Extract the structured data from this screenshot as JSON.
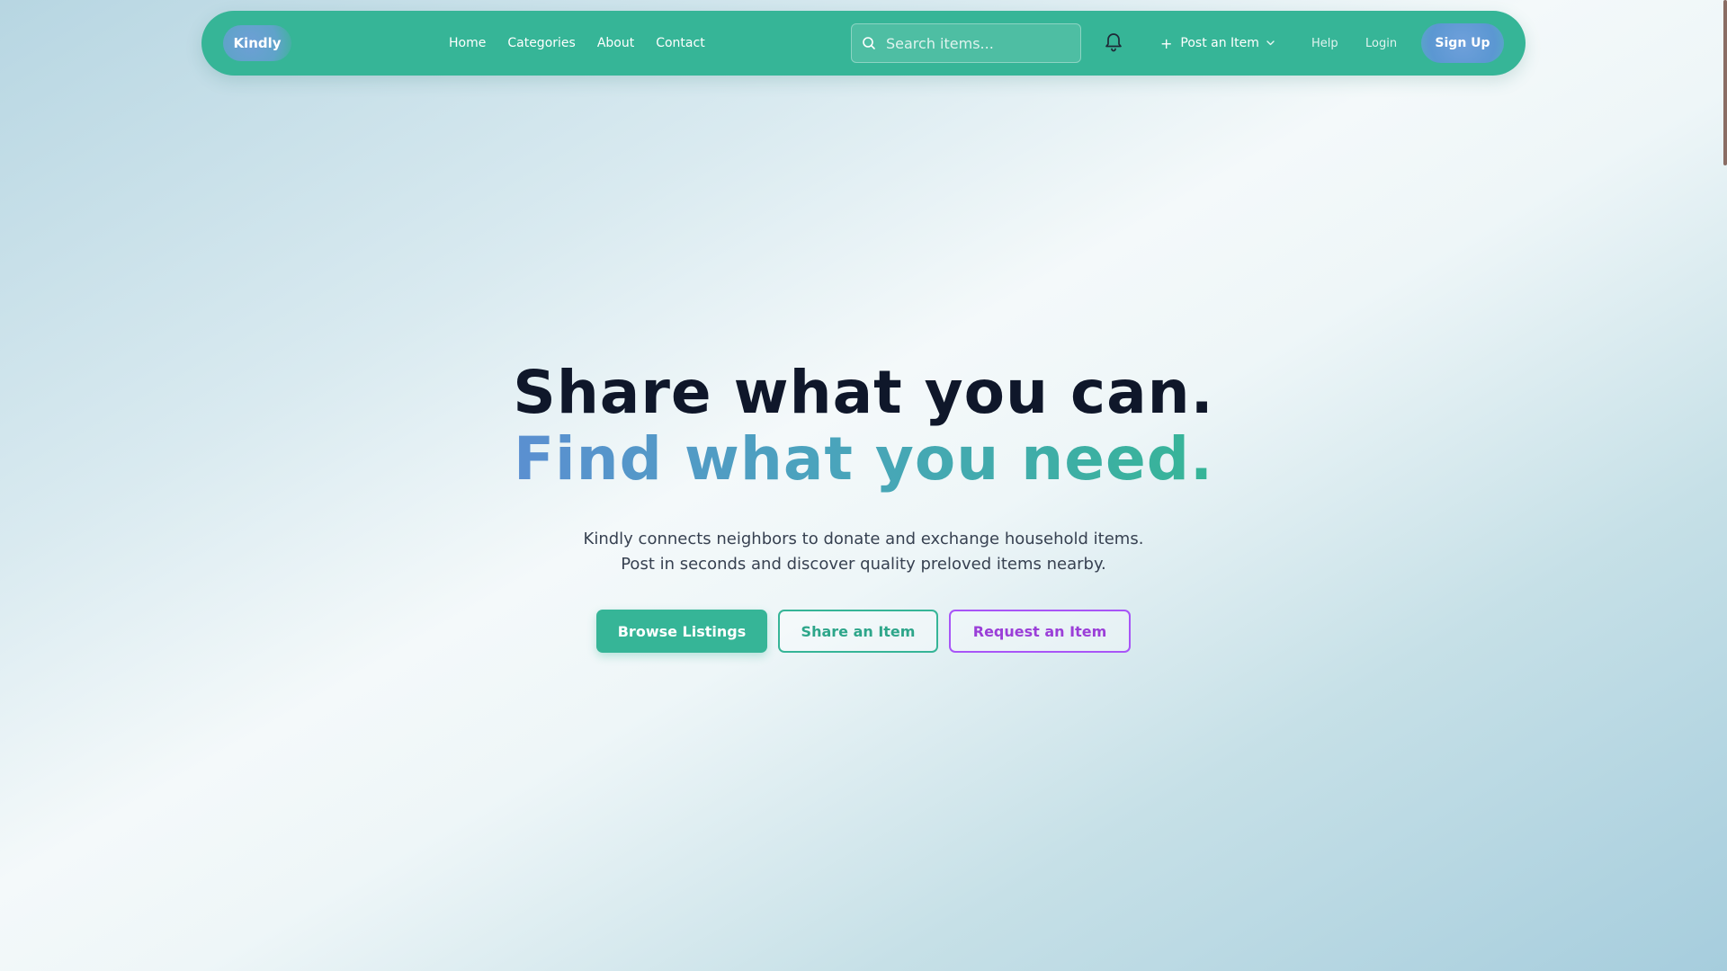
{
  "brand": {
    "name": "Kindly"
  },
  "nav": {
    "links": [
      "Home",
      "Categories",
      "About",
      "Contact"
    ]
  },
  "search": {
    "placeholder": "Search items..."
  },
  "header_actions": {
    "post_label": "Post an Item",
    "help_label": "Help",
    "login_label": "Login",
    "signup_label": "Sign Up"
  },
  "icons": {
    "search": "search-icon",
    "notifications": "bell-icon",
    "post_plus": "plus-icon",
    "post_menu": "chevron-down-icon"
  },
  "hero": {
    "headline_line1": "Share what you can.",
    "headline_line2": "Find what you need.",
    "subtitle_line1": "Kindly connects neighbors to donate and exchange household items.",
    "subtitle_line2": "Post in seconds and discover quality preloved items nearby."
  },
  "cta": {
    "browse_label": "Browse Listings",
    "share_label": "Share an Item",
    "request_label": "Request an Item"
  },
  "colors": {
    "primary": "#36b597",
    "accent_blue": "#5b8fd1",
    "accent_purple": "#a855f7",
    "heading": "#0f172a"
  }
}
